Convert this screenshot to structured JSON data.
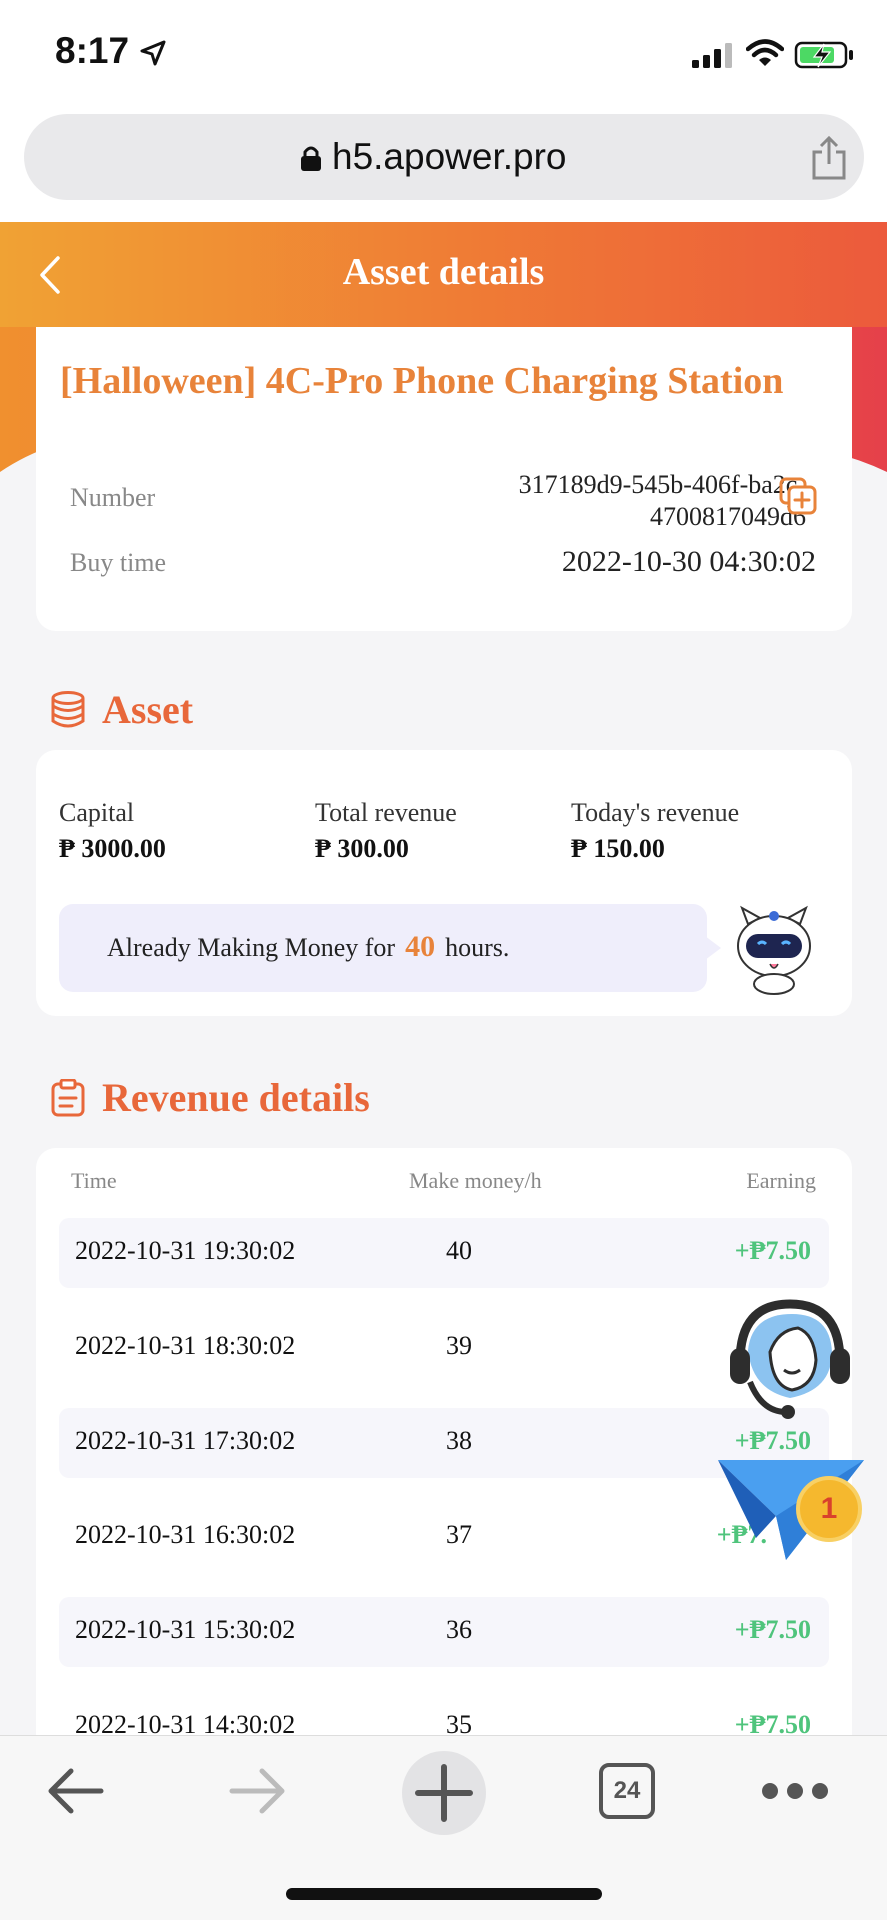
{
  "status_bar": {
    "time": "8:17"
  },
  "browser": {
    "url": "h5.apower.pro",
    "tab_count": "24"
  },
  "header": {
    "title": "Asset details"
  },
  "product": {
    "title": "[Halloween] 4C-Pro Phone Charging Station",
    "number_label": "Number",
    "number_value_line1": "317189d9-545b-406f-ba2c-",
    "number_value_line2": "4700817049d6",
    "buy_time_label": "Buy time",
    "buy_time_value": "2022-10-30 04:30:02"
  },
  "asset": {
    "section_title": "Asset",
    "capital_label": "Capital",
    "capital_value": "₱ 3000.00",
    "total_revenue_label": "Total revenue",
    "total_revenue_value": "₱ 300.00",
    "today_revenue_label": "Today's revenue",
    "today_revenue_value": "₱ 150.00",
    "making_prefix": "Already Making Money for",
    "making_hours": "40",
    "making_suffix": "hours."
  },
  "revenue": {
    "section_title": "Revenue details",
    "columns": [
      "Time",
      "Make money/h",
      "Earning"
    ],
    "rows": [
      {
        "time": "2022-10-31 19:30:02",
        "money": "40",
        "earning": "+₱7.50"
      },
      {
        "time": "2022-10-31 18:30:02",
        "money": "39",
        "earning": ""
      },
      {
        "time": "2022-10-31 17:30:02",
        "money": "38",
        "earning": "+₱7.50"
      },
      {
        "time": "2022-10-31 16:30:02",
        "money": "37",
        "earning": "+₱7."
      },
      {
        "time": "2022-10-31 15:30:02",
        "money": "36",
        "earning": "+₱7.50"
      },
      {
        "time": "2022-10-31 14:30:02",
        "money": "35",
        "earning": "+₱7.50"
      }
    ]
  },
  "floating": {
    "badge_count": "1"
  },
  "colors": {
    "accent": "#e8833a",
    "header_start": "#f0a234",
    "header_end": "#ec5a3c",
    "earning": "#4fc47c"
  }
}
